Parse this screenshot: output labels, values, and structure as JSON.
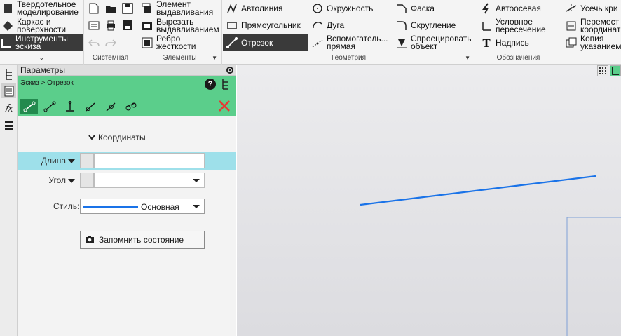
{
  "ribbon": {
    "left_group": {
      "items": [
        "Твердотельное моделирование",
        "Каркас и поверхности",
        "Инструменты эскиза"
      ]
    },
    "systemic": {
      "label": "Системная"
    },
    "elements": {
      "label": "Элементы",
      "items": [
        "Элемент выдавливания",
        "Вырезать выдавливанием",
        "Ребро жесткости"
      ]
    },
    "geometry": {
      "label": "Геометрия",
      "col1": [
        "Автолиния",
        "Прямоугольник",
        "Отрезок"
      ],
      "col2": [
        "Окружность",
        "Дуга",
        "Вспомогательная прямая"
      ],
      "col3": [
        "Фаска",
        "Скругление",
        "Спроецировать объект"
      ]
    },
    "designations": {
      "label": "Обозначения",
      "items": [
        "Автоосевая",
        "Условное пересечение",
        "Надпись"
      ]
    },
    "rightmost": {
      "items": [
        "Усечь кри",
        "Перемест координат",
        "Копия указанием"
      ]
    }
  },
  "ribbon_multiline": {
    "item0_l1": "Твердотельное",
    "item0_l2": "моделирование",
    "item1_l1": "Каркас и",
    "item1_l2": "поверхности",
    "item2_l1": "Инструменты",
    "item2_l2": "эскиза",
    "el0_l1": "Элемент",
    "el0_l2": "выдавливания",
    "el1_l1": "Вырезать",
    "el1_l2": "выдавливанием",
    "el2_l1": "Ребро",
    "el2_l2": "жесткости",
    "g_aux_l1": "Вспомогатель...",
    "g_aux_l2": "прямая",
    "g_proj_l1": "Спроецировать",
    "g_proj_l2": "объект",
    "d_cond_l1": "Условное",
    "d_cond_l2": "пересечение",
    "r1_l1": "Перемест",
    "r1_l2": "координат",
    "r2_l1": "Копия",
    "r2_l2": "указанием"
  },
  "panel": {
    "title": "Параметры",
    "breadcrumb": "Эскиз > Отрезок",
    "section": "Координаты",
    "length_label": "Длина",
    "length_value": "",
    "angle_label": "Угол",
    "angle_value": "",
    "style_label": "Стиль:",
    "style_value": "Основная",
    "save_button": "Запомнить состояние"
  },
  "colors": {
    "accent_green": "#5bce8b",
    "highlight_cyan": "#9ee0ea",
    "line_blue": "#1a73e8",
    "close_red": "#e53935"
  }
}
